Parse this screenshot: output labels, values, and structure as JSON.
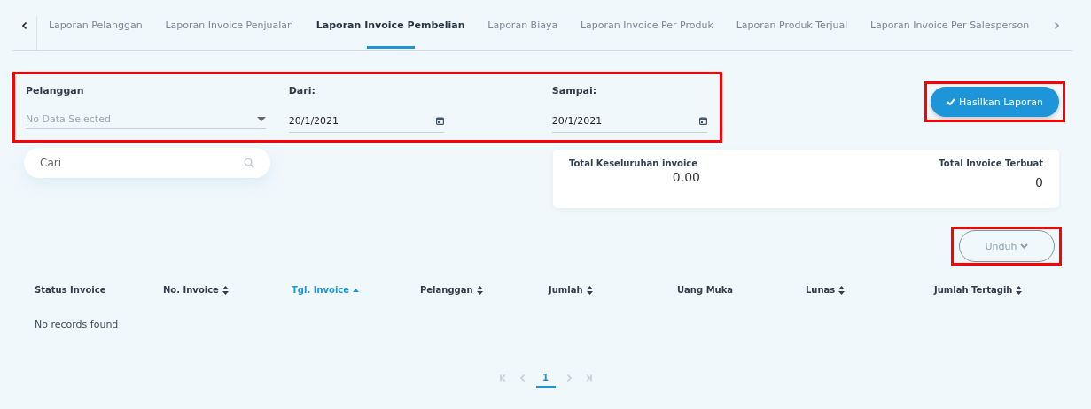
{
  "tabs": [
    {
      "label": "Laporan Pelanggan",
      "selected": false
    },
    {
      "label": "Laporan Invoice Penjualan",
      "selected": false
    },
    {
      "label": "Laporan Invoice Pembelian",
      "selected": true
    },
    {
      "label": "Laporan Biaya",
      "selected": false
    },
    {
      "label": "Laporan Invoice Per Produk",
      "selected": false
    },
    {
      "label": "Laporan Produk Terjual",
      "selected": false
    },
    {
      "label": "Laporan Invoice Per Salesperson",
      "selected": false
    }
  ],
  "filters": {
    "highlighted": true,
    "customer": {
      "label": "Pelanggan",
      "placeholder": "No Data Selected"
    },
    "from": {
      "label": "Dari:",
      "value": "20/1/2021"
    },
    "to": {
      "label": "Sampai:",
      "value": "20/1/2021"
    }
  },
  "generate_button": {
    "label": "Hasilkan Laporan",
    "highlighted": true
  },
  "search": {
    "placeholder": "Cari"
  },
  "summary": {
    "total_label": "Total Keseluruhan invoice",
    "total_value": "0.00",
    "count_label": "Total Invoice Terbuat",
    "count_value": "0"
  },
  "download_button": {
    "label": "Unduh",
    "highlighted": true
  },
  "table": {
    "columns": [
      {
        "label": "Status Invoice",
        "sortable": false,
        "sorted": false
      },
      {
        "label": "No. Invoice",
        "sortable": true,
        "sorted": false
      },
      {
        "label": "Tgl. Invoice",
        "sortable": true,
        "sorted": true
      },
      {
        "label": "Pelanggan",
        "sortable": true,
        "sorted": false
      },
      {
        "label": "Jumlah",
        "sortable": true,
        "sorted": false
      },
      {
        "label": "Uang Muka",
        "sortable": false,
        "sorted": false
      },
      {
        "label": "Lunas",
        "sortable": true,
        "sorted": false
      },
      {
        "label": "Jumlah Tertagih",
        "sortable": true,
        "sorted": false
      }
    ],
    "empty_message": "No records found"
  },
  "pagination": {
    "pages": [
      {
        "label": "1",
        "selected": true
      }
    ]
  }
}
